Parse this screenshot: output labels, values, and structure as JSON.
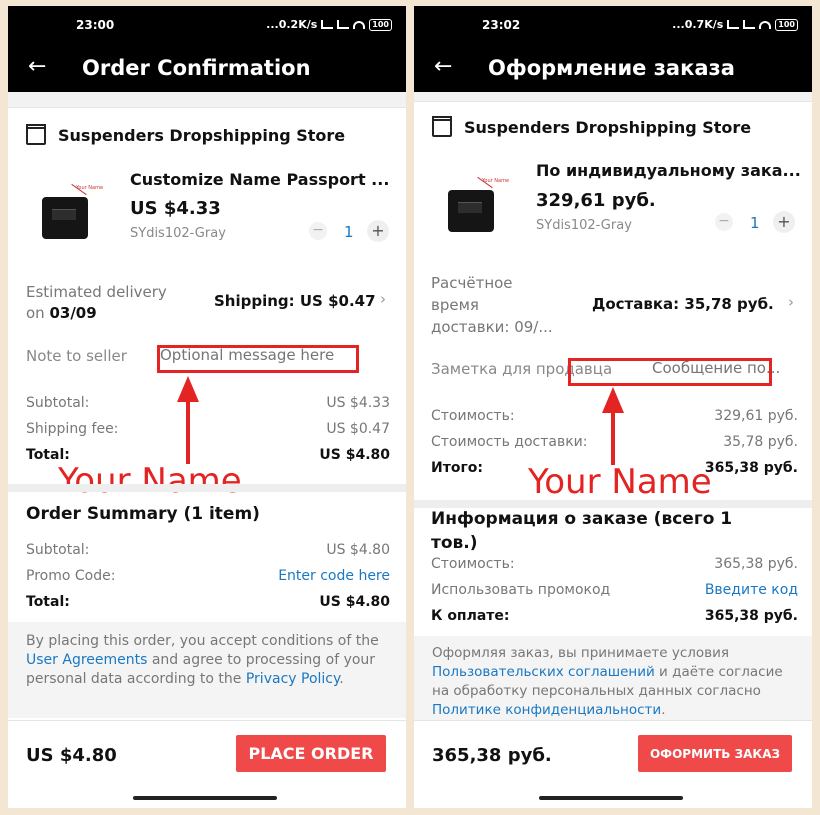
{
  "left": {
    "status": {
      "time": "23:00",
      "speed": "...0.2K/s",
      "battery": "100"
    },
    "nav": {
      "back": "←",
      "title": "Order Confirmation"
    },
    "store": {
      "name": "Suspenders Dropshipping Store"
    },
    "product": {
      "name": "Customize Name Passport ...",
      "price": "US $4.33",
      "sku": "SYdis102-Gray",
      "qty": "1",
      "minus": "−",
      "plus": "+",
      "img_tag": "Your Name"
    },
    "delivery": {
      "label_line1": "Estimated delivery",
      "label_line2_prefix": "on ",
      "label_line2_date": "03/09",
      "shipping": "Shipping: US $0.47",
      "chevron": "›"
    },
    "note": {
      "label": "Note to seller",
      "placeholder": "Optional message here"
    },
    "costs": [
      {
        "label": "Subtotal:",
        "value": "US $4.33"
      },
      {
        "label": "Shipping fee:",
        "value": "US $0.47"
      },
      {
        "label": "Total:",
        "value": "US $4.80"
      }
    ],
    "annotation": "Your Name",
    "summary": {
      "title": "Order Summary (1 item)",
      "rows": [
        {
          "label": "Subtotal:",
          "value": "US $4.80"
        },
        {
          "label": "Promo Code:",
          "value": "Enter code here"
        },
        {
          "label": "Total:",
          "value": "US $4.80"
        }
      ]
    },
    "disclaimer": {
      "p1": "By placing this order, you accept conditions of the ",
      "link1": "User Agreements",
      "p2": " and agree to processing of your personal data according to the ",
      "link2": "Privacy Policy",
      "p3": "."
    },
    "footer": {
      "total": "US $4.80",
      "button": "PLACE ORDER"
    }
  },
  "right": {
    "status": {
      "time": "23:02",
      "speed": "...0.7K/s",
      "battery": "100"
    },
    "nav": {
      "back": "←",
      "title": "Оформление заказа"
    },
    "store": {
      "name": "Suspenders Dropshipping Store"
    },
    "product": {
      "name": "По индивидуальному зака...",
      "price": "329,61 руб.",
      "sku": "SYdis102-Gray",
      "qty": "1",
      "minus": "−",
      "plus": "+",
      "img_tag": "Your Name"
    },
    "delivery": {
      "line1": "Расчётное",
      "line2": "время",
      "line3": "доставки: 09/...",
      "shipping": "Доставка: 35,78 руб.",
      "chevron": "›"
    },
    "note": {
      "label": "Заметка для продавца",
      "placeholder": "Сообщение по..."
    },
    "costs": [
      {
        "label": "Стоимость:",
        "value": "329,61 руб."
      },
      {
        "label": "Стоимость доставки:",
        "value": "35,78 руб."
      },
      {
        "label": "Итого:",
        "value": "365,38 руб."
      }
    ],
    "annotation": "Your Name",
    "summary": {
      "title_line1": "Информация о заказе (всего 1",
      "title_line2": "тов.)",
      "rows": [
        {
          "label": "Стоимость:",
          "value": "365,38 руб."
        },
        {
          "label": "Использовать промокод",
          "value": "Введите код"
        },
        {
          "label": "К оплате:",
          "value": "365,38 руб."
        }
      ]
    },
    "disclaimer": {
      "p1": "Оформляя заказ, вы принимаете условия ",
      "link1": "Пользовательских соглашений",
      "p2": " и даёте согласие на обработку персональных данных согласно ",
      "link2": "Политике конфиденциальности",
      "p3": "."
    },
    "footer": {
      "total": "365,38 руб.",
      "button": "ОФОРМИТЬ ЗАКАЗ"
    }
  },
  "colors": {
    "accent_red": "#f0494a",
    "annotation_red": "#e42323",
    "link_blue": "#1a78c2",
    "qty_blue": "#1a78c2",
    "background": "#f3e6d3"
  },
  "icons": [
    "back-arrow-icon",
    "store-icon",
    "signal-icon",
    "wifi-icon",
    "battery-icon",
    "chevron-right-icon"
  ]
}
